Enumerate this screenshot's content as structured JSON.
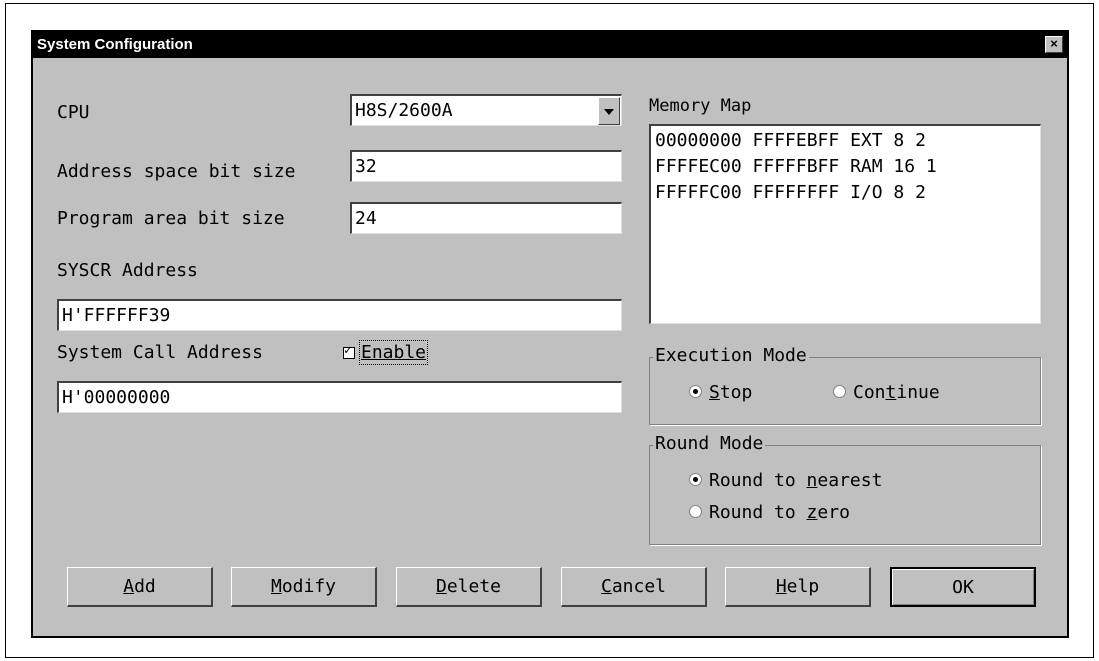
{
  "dialog": {
    "title": "System Configuration",
    "close_glyph": "×"
  },
  "cpu": {
    "label": "CPU",
    "selected": "H8S/2600A"
  },
  "address_space": {
    "label": "Address space bit size",
    "value": "32"
  },
  "program_area": {
    "label": "Program area bit size",
    "value": "24"
  },
  "syscr": {
    "label": "SYSCR Address",
    "value": "H'FFFFFF39"
  },
  "system_call": {
    "label": "System Call Address",
    "enable_label": "Enable",
    "enabled": true,
    "value": "H'00000000"
  },
  "memory_map": {
    "label": "Memory Map",
    "rows": [
      "00000000 FFFFEBFF EXT 8 2",
      "FFFFEC00 FFFFFBFF RAM 16 1",
      "FFFFFC00 FFFFFFFF I/O 8 2"
    ]
  },
  "execution_mode": {
    "label": "Execution Mode",
    "options": [
      {
        "pre": "",
        "key": "S",
        "post": "top",
        "selected": true
      },
      {
        "pre": "Con",
        "key": "t",
        "post": "inue",
        "selected": false
      }
    ]
  },
  "round_mode": {
    "label": "Round Mode",
    "options": [
      {
        "pre": "Round to ",
        "key": "n",
        "post": "earest",
        "selected": true
      },
      {
        "pre": "Round to ",
        "key": "z",
        "post": "ero",
        "selected": false
      }
    ]
  },
  "buttons": {
    "add": {
      "key": "A",
      "post": "dd"
    },
    "modify": {
      "key": "M",
      "post": "odify"
    },
    "delete": {
      "key": "D",
      "post": "elete"
    },
    "cancel": {
      "key": "C",
      "post": "ancel"
    },
    "help": {
      "key": "H",
      "post": "elp"
    },
    "ok": {
      "label": "OK"
    }
  }
}
